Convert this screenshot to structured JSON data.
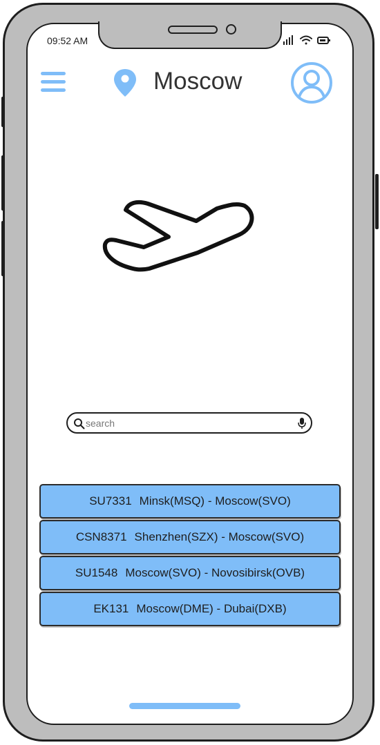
{
  "status_bar": {
    "time": "09:52 AM",
    "icons": [
      "signal-icon",
      "wifi-icon",
      "battery-icon"
    ]
  },
  "header": {
    "menu_icon": "hamburger-menu-icon",
    "location_icon": "map-pin-icon",
    "city": "Moscow",
    "profile_icon": "user-avatar-icon"
  },
  "hero": {
    "icon": "airplane-takeoff-icon"
  },
  "search": {
    "placeholder": "search",
    "value": "",
    "icon": "search-icon",
    "voice_icon": "microphone-icon"
  },
  "flights": [
    {
      "code": "SU7331",
      "route": "Minsk(MSQ) - Moscow(SVO)"
    },
    {
      "code": "CSN8371",
      "route": "Shenzhen(SZX) - Moscow(SVO)"
    },
    {
      "code": "SU1548",
      "route": "Moscow(SVO) - Novosibirsk(OVB)"
    },
    {
      "code": "EK131",
      "route": "Moscow(DME) - Dubai(DXB)"
    }
  ],
  "colors": {
    "accent": "#7fbdf8",
    "frame": "#bdbdbd",
    "outline": "#1e1e1e"
  }
}
